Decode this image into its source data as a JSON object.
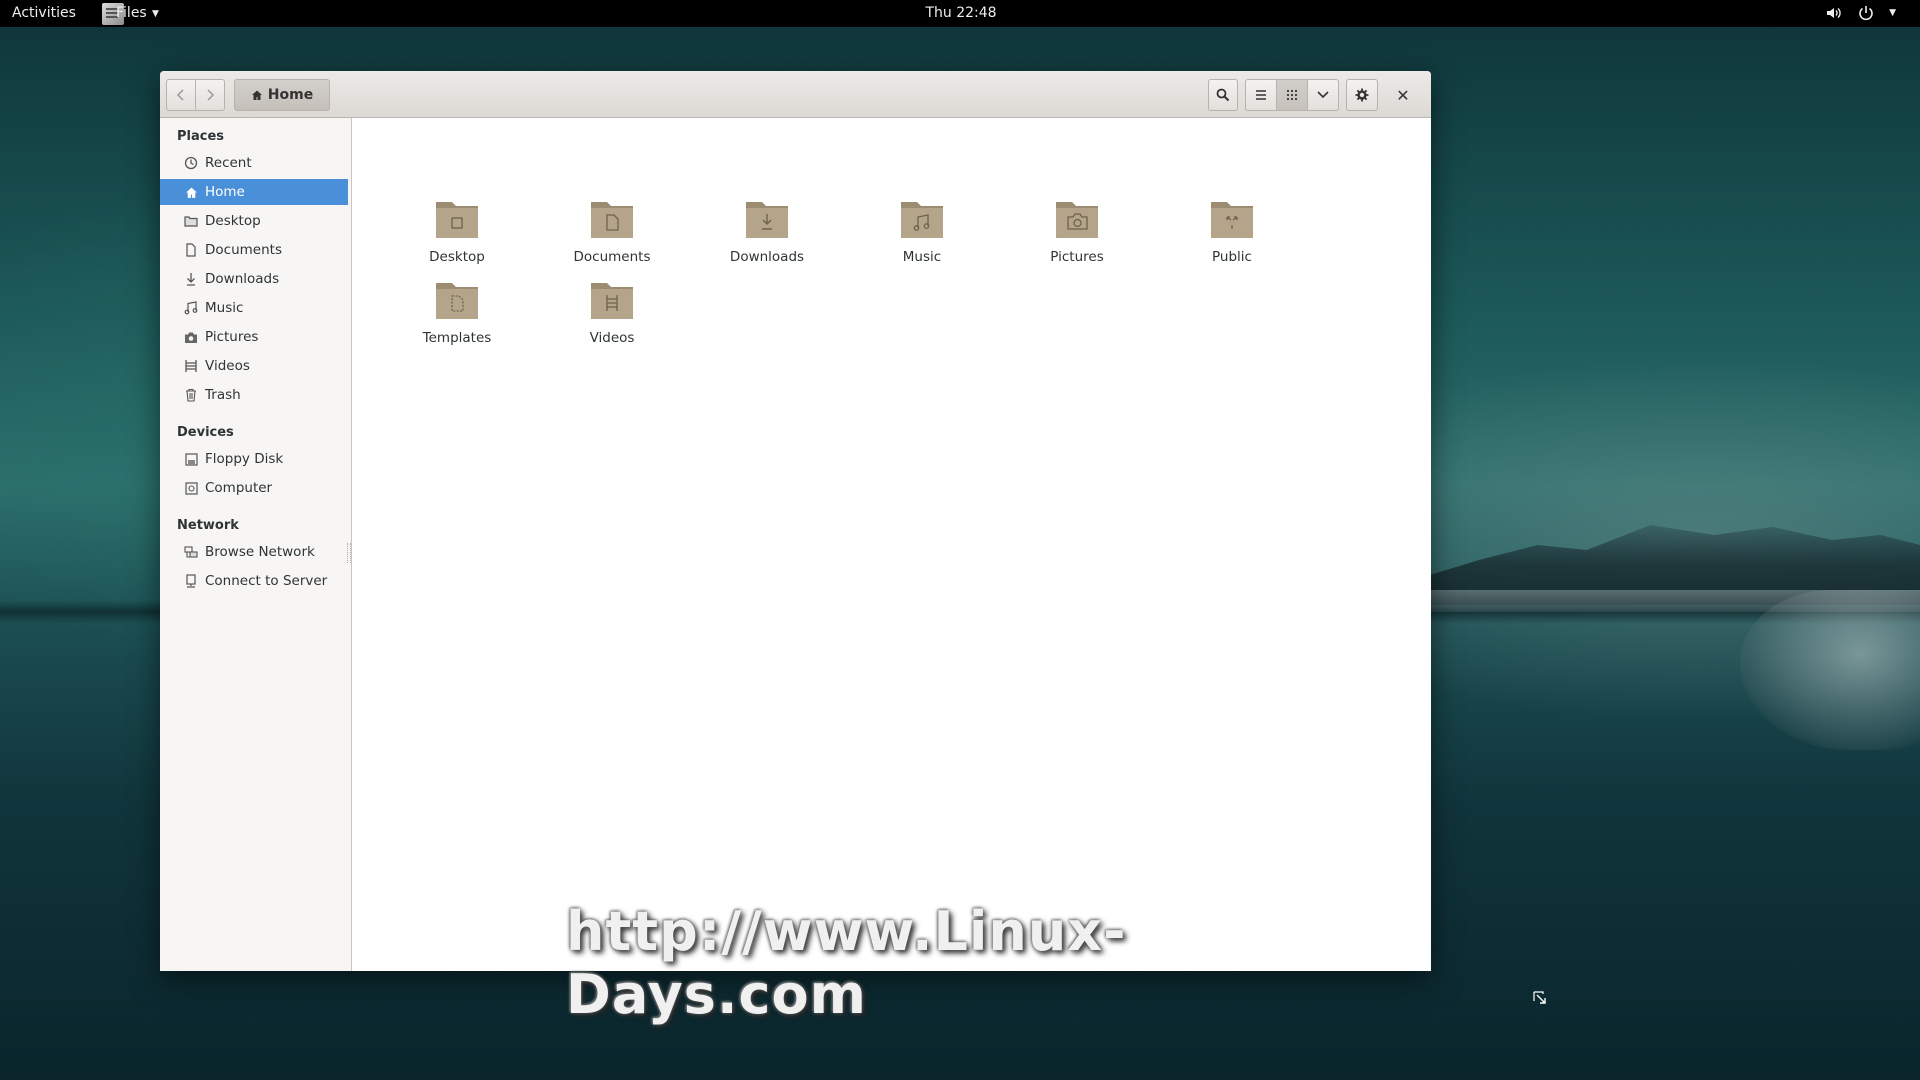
{
  "topbar": {
    "activities": "Activities",
    "app_name": "Files",
    "clock": "Thu 22:48"
  },
  "window": {
    "path_button": "Home",
    "sidebar": {
      "places_heading": "Places",
      "places": [
        {
          "label": "Recent",
          "icon": "clock-icon"
        },
        {
          "label": "Home",
          "icon": "home-icon",
          "active": true
        },
        {
          "label": "Desktop",
          "icon": "desktop-icon"
        },
        {
          "label": "Documents",
          "icon": "document-icon"
        },
        {
          "label": "Downloads",
          "icon": "download-icon"
        },
        {
          "label": "Music",
          "icon": "music-icon"
        },
        {
          "label": "Pictures",
          "icon": "camera-icon"
        },
        {
          "label": "Videos",
          "icon": "film-icon"
        },
        {
          "label": "Trash",
          "icon": "trash-icon"
        }
      ],
      "devices_heading": "Devices",
      "devices": [
        {
          "label": "Floppy Disk",
          "icon": "floppy-icon"
        },
        {
          "label": "Computer",
          "icon": "computer-icon"
        }
      ],
      "network_heading": "Network",
      "network": [
        {
          "label": "Browse Network",
          "icon": "network-icon"
        },
        {
          "label": "Connect to Server",
          "icon": "server-icon"
        }
      ]
    },
    "files": [
      {
        "label": "Desktop",
        "icon": "desktop-folder-icon"
      },
      {
        "label": "Documents",
        "icon": "documents-folder-icon"
      },
      {
        "label": "Downloads",
        "icon": "downloads-folder-icon"
      },
      {
        "label": "Music",
        "icon": "music-folder-icon"
      },
      {
        "label": "Pictures",
        "icon": "pictures-folder-icon"
      },
      {
        "label": "Public",
        "icon": "public-folder-icon"
      },
      {
        "label": "Templates",
        "icon": "templates-folder-icon"
      },
      {
        "label": "Videos",
        "icon": "videos-folder-icon"
      }
    ]
  },
  "watermark": "http://www.Linux-Days.com",
  "colors": {
    "selection": "#4a90d9",
    "folder": "#b4a48a",
    "topbar": "#000000"
  }
}
